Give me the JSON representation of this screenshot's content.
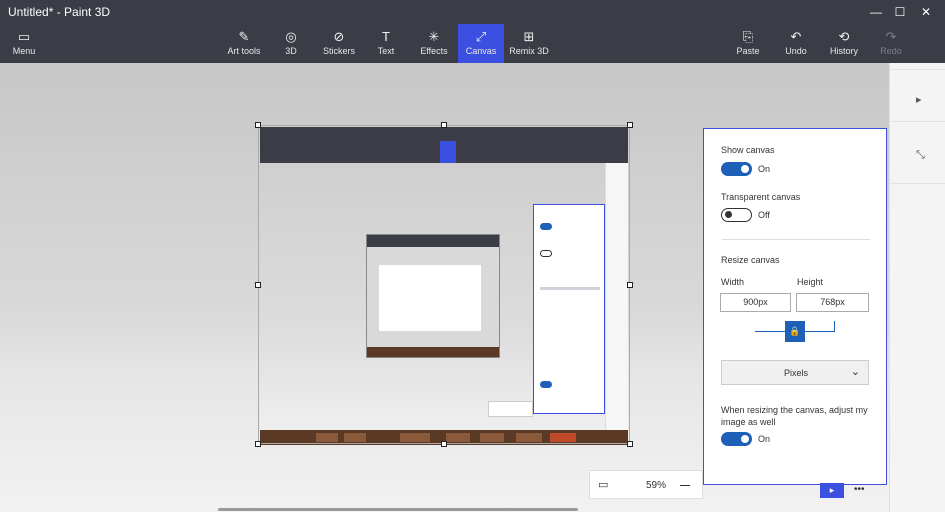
{
  "window": {
    "title": "Untitled* - Paint 3D",
    "minimize": "—",
    "restore": "☐",
    "close": "✕"
  },
  "toolbar": {
    "menu": {
      "label": "Menu",
      "icon": "folder-icon",
      "glyph": "▭"
    },
    "tools": [
      {
        "label": "Art tools",
        "icon": "brush-icon",
        "glyph": "✎"
      },
      {
        "label": "3D",
        "icon": "cube-icon",
        "glyph": "◎"
      },
      {
        "label": "Stickers",
        "icon": "sticker-icon",
        "glyph": "⊘"
      },
      {
        "label": "Text",
        "icon": "text-icon",
        "glyph": "T"
      },
      {
        "label": "Effects",
        "icon": "effects-icon",
        "glyph": "✳"
      },
      {
        "label": "Canvas",
        "icon": "canvas-icon",
        "glyph": "⤢"
      },
      {
        "label": "Remix 3D",
        "icon": "remix-icon",
        "glyph": "⊞"
      }
    ],
    "right": [
      {
        "label": "Paste",
        "icon": "paste-icon",
        "glyph": "⎘"
      },
      {
        "label": "Undo",
        "icon": "undo-icon",
        "glyph": "↶"
      },
      {
        "label": "History",
        "icon": "history-icon",
        "glyph": "⟲"
      },
      {
        "label": "Redo",
        "icon": "redo-icon",
        "glyph": "↷"
      }
    ],
    "accent": "#3b50e0"
  },
  "canvas_panel": {
    "show_canvas_label": "Show canvas",
    "show_canvas_state": "On",
    "transparent_label": "Transparent canvas",
    "transparent_state": "Off",
    "resize_label": "Resize canvas",
    "width_label": "Width",
    "height_label": "Height",
    "width_value": "900px",
    "height_value": "768px",
    "lock_glyph": "🔒",
    "units_value": "Pixels",
    "units_chev": "⌄",
    "adjust_label_1": "When resizing the canvas, adjust my",
    "adjust_label_2": "image as well",
    "adjust_state": "On"
  },
  "zoom": {
    "percent": "59%",
    "view_glyph": "▭",
    "pointer_glyph": "▸",
    "more_glyph": "•••"
  },
  "side": {
    "select_glyph": "▸",
    "crop_glyph": "⤡"
  },
  "colors": {
    "titlebar": "#3a3d45",
    "toggle_on": "#1e5fb8",
    "accent": "#3b50e0"
  }
}
